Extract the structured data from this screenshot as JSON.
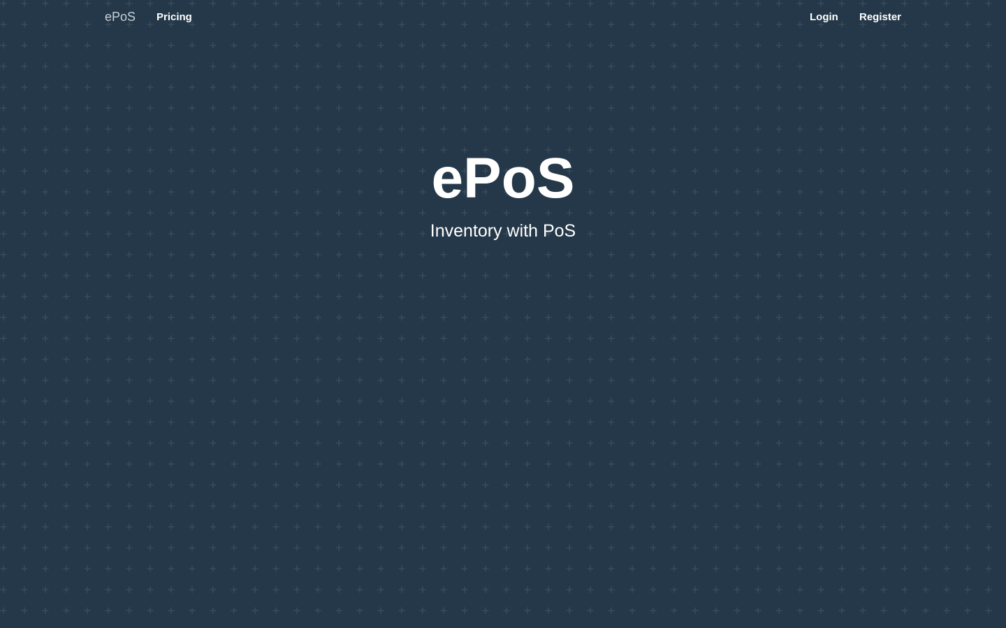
{
  "nav": {
    "brand": "ePoS",
    "pricing": "Pricing",
    "login": "Login",
    "register": "Register"
  },
  "hero": {
    "title": "ePoS",
    "subtitle": "Inventory with PoS"
  },
  "colors": {
    "background": "#243849",
    "pattern": "#3a4e60",
    "text": "#ffffff",
    "brand": "#c9d1d9"
  }
}
